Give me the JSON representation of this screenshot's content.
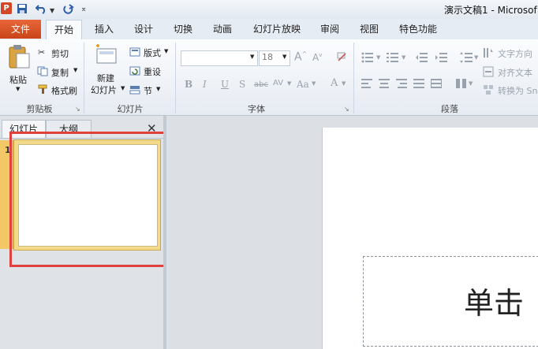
{
  "window": {
    "title": "演示文稿1 - Microsof"
  },
  "quick_access": {
    "icons": [
      "app-logo-icon",
      "save-icon",
      "undo-icon",
      "redo-icon",
      "customize-icon"
    ]
  },
  "tabs": {
    "file": "文件",
    "items": [
      "开始",
      "插入",
      "设计",
      "切换",
      "动画",
      "幻灯片放映",
      "审阅",
      "视图",
      "特色功能"
    ],
    "active": "开始"
  },
  "ribbon": {
    "clipboard": {
      "paste": "粘贴",
      "cut": "剪切",
      "copy": "复制",
      "format_painter": "格式刷",
      "label": "剪贴板"
    },
    "slides": {
      "new_slide_line1": "新建",
      "new_slide_line2": "幻灯片",
      "layout": "版式",
      "reset": "重设",
      "section": "节",
      "label": "幻灯片"
    },
    "font": {
      "size": "18",
      "label": "字体",
      "bold": "B",
      "italic": "I",
      "underline": "U",
      "strike": "S",
      "abc": "abc",
      "av": "AV",
      "aa": "Aa",
      "a": "A"
    },
    "paragraph": {
      "text_direction": "文字方向",
      "align_text": "对齐文本",
      "convert": "转换为 Sn",
      "label": "段落"
    }
  },
  "left_pane": {
    "tab_slides": "幻灯片",
    "tab_outline": "大纲",
    "slide_number": "1"
  },
  "slide": {
    "placeholder_text": "单击"
  },
  "colors": {
    "file_tab": "#d84d22",
    "highlight": "#e0413c",
    "thumb_border": "#f3d98a"
  }
}
